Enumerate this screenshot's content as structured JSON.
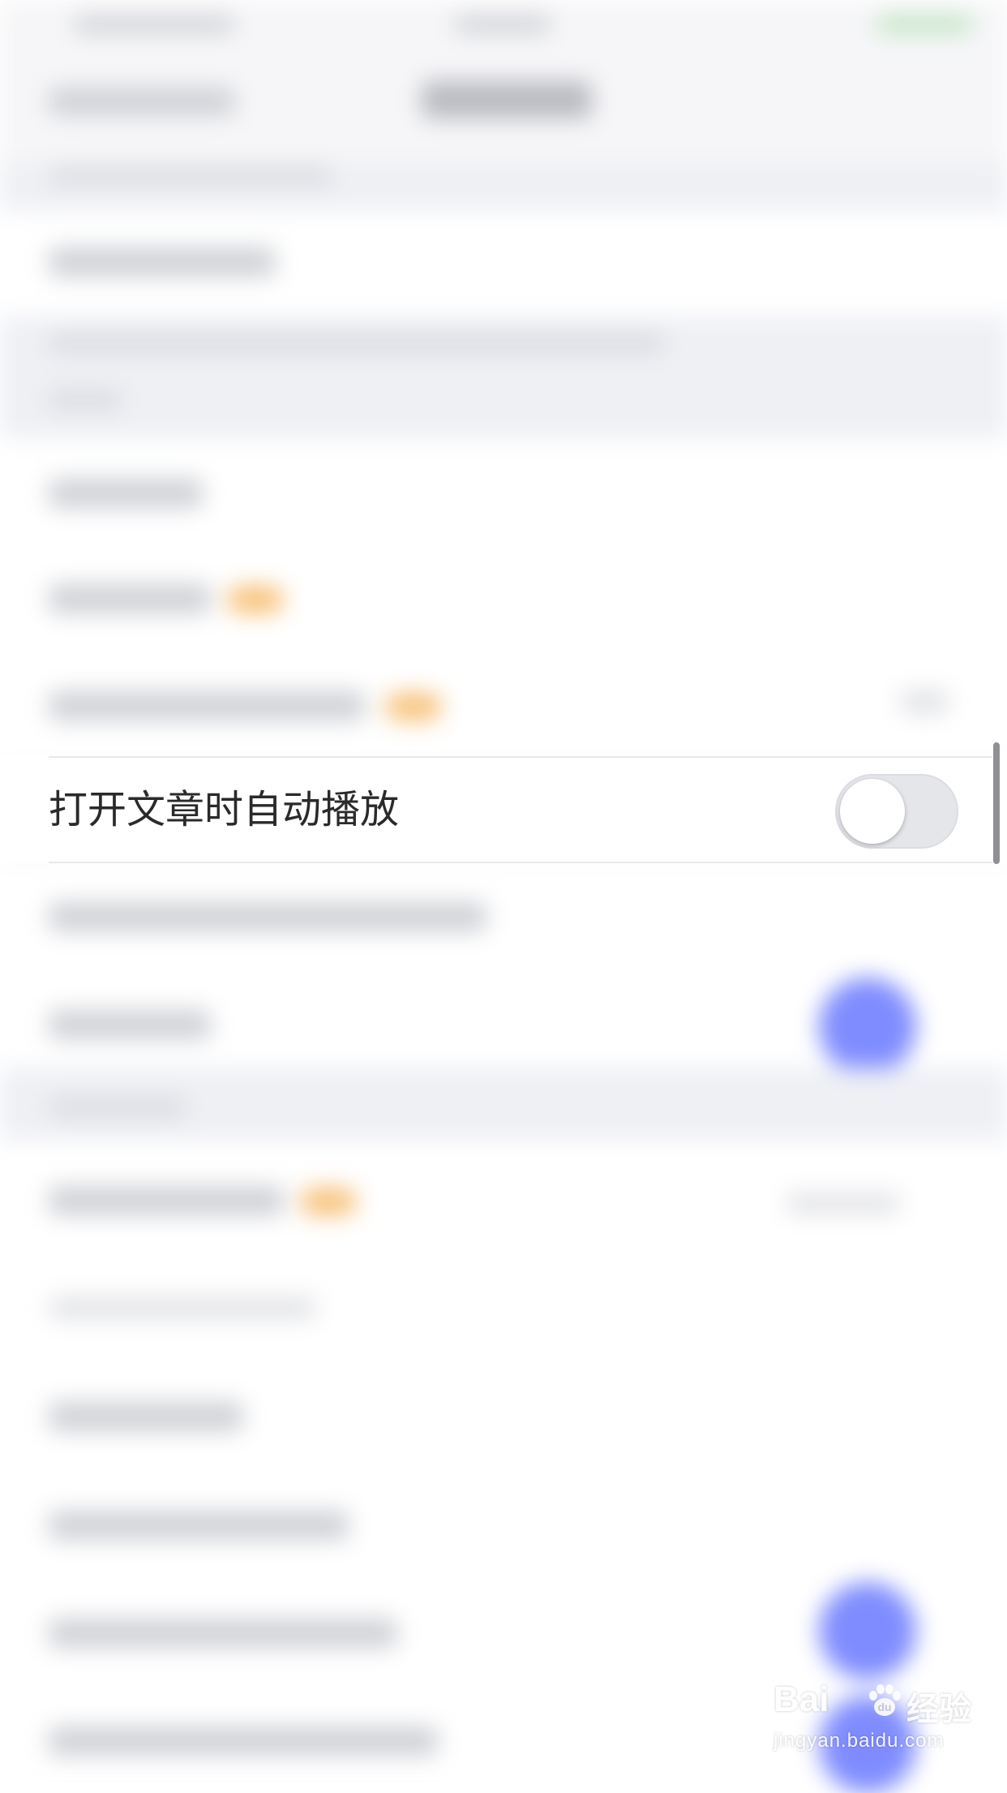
{
  "settings": {
    "focused_row": {
      "label": "打开文章时自动播放",
      "toggle_state": "off"
    }
  },
  "watermark": {
    "brand": "Bai",
    "brand_cn": "经验",
    "url": "jingyan.baidu.com"
  },
  "colors": {
    "toggle_track_off": "#e5e6ea",
    "toggle_knob": "#ffffff",
    "accent_blue": "#7f8cff",
    "badge_orange": "#f7c27a"
  }
}
